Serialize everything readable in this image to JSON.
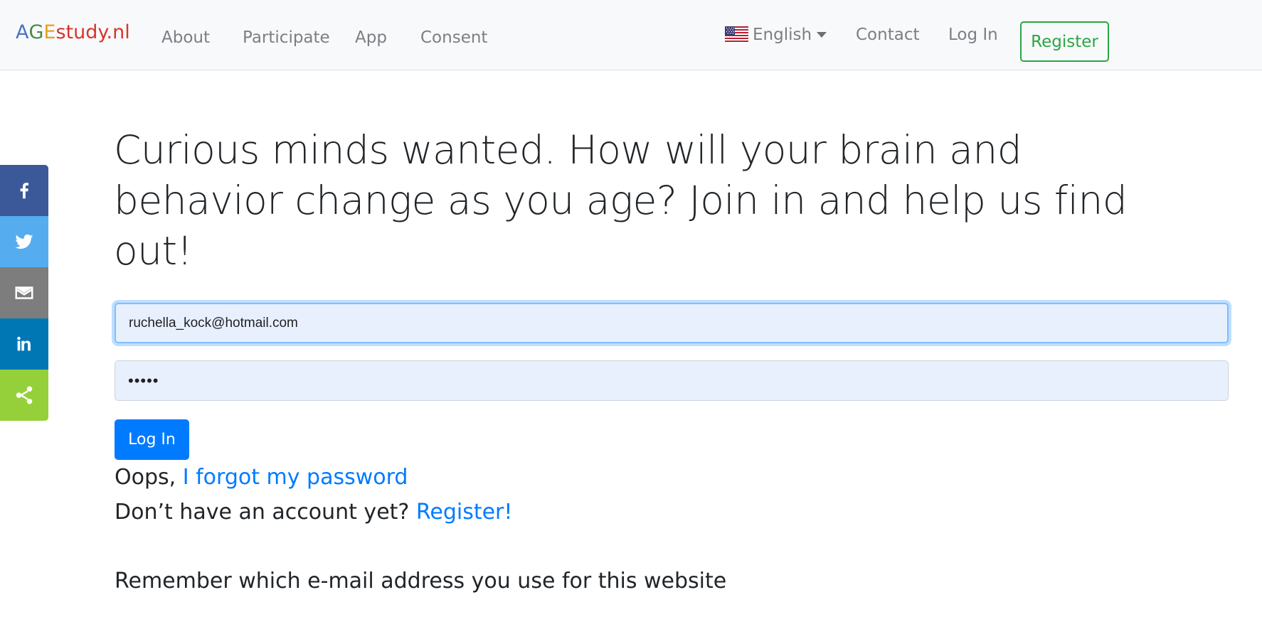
{
  "navbar": {
    "brand": {
      "parts": [
        {
          "text": "A",
          "color": "#4a72c4"
        },
        {
          "text": "G",
          "color": "#4a8a4a"
        },
        {
          "text": "E",
          "color": "#e8a020"
        },
        {
          "text": "study.nl",
          "color": "#d9342b"
        }
      ]
    },
    "links": {
      "about": "About",
      "participate": "Participate",
      "app": "App",
      "consent": "Consent"
    },
    "language": {
      "label": "English",
      "flag_icon": "us-flag-icon"
    },
    "contact": "Contact",
    "login": "Log In",
    "register": "Register"
  },
  "social": [
    {
      "icon": "facebook-icon"
    },
    {
      "icon": "twitter-icon"
    },
    {
      "icon": "email-icon"
    },
    {
      "icon": "linkedin-icon"
    },
    {
      "icon": "share-icon"
    }
  ],
  "hero": {
    "headline": "Curious minds wanted. How will your brain and behavior change as you age? Join in and help us find out!"
  },
  "form": {
    "email_value": "ruchella_kock@hotmail.com",
    "password_value": "•••••",
    "login_button": "Log In",
    "oops_prefix": "Oops, ",
    "forgot_link": "I forgot my password",
    "no_account_prefix": "Don’t have an account yet? ",
    "register_link": "Register!",
    "remember_text": "Remember which e-mail address you use for this website"
  },
  "colors": {
    "primary": "#007bff",
    "success": "#28a745",
    "navbar_bg": "#f8f9fa"
  }
}
